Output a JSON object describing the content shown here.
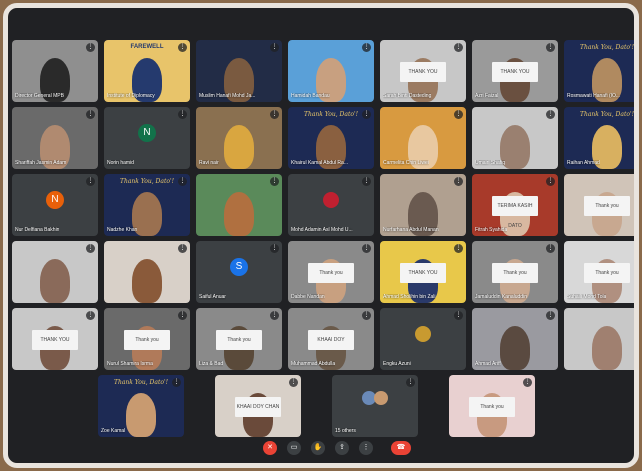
{
  "meeting": {
    "participants": [
      {
        "name": "Director General MPB",
        "bg": "#8f8f8f",
        "person": "#2a2a2a",
        "type": "video"
      },
      {
        "name": "Institute of Diplomacy",
        "bg": "#e8c46a",
        "person": "#253a6e",
        "type": "farewell",
        "banner": "FAREWELL"
      },
      {
        "name": "Muslim Hanafi Mohd Ja...",
        "bg": "#222c46",
        "person": "#7a5a40",
        "type": "video"
      },
      {
        "name": "Hamidah Bandau",
        "bg": "#5aa0d8",
        "person": "#c8a080",
        "type": "sign"
      },
      {
        "name": "Sarah Binti Dasteding",
        "bg": "#c7c7c7",
        "person": "#9b7b62",
        "type": "sign",
        "sign": "THANK YOU"
      },
      {
        "name": "Azri Faizal",
        "bg": "#9a9a9a",
        "person": "#6a5040",
        "type": "sign",
        "sign": "THANK YOU"
      },
      {
        "name": "Rosmawati Hanafi (IO...",
        "bg": "#1d2a54",
        "person": "#b08a60",
        "type": "banner",
        "banner": "Thank You, Dato'!"
      },
      {
        "name": "Shariffah Jasmin Adam",
        "bg": "#6a6a6a",
        "person": "#b08a70",
        "type": "video"
      },
      {
        "name": "Norin hamid",
        "bg": "#3c4043",
        "type": "avatar",
        "initial": "N",
        "avatar_color": "#12724a"
      },
      {
        "name": "Ravi nair",
        "bg": "#8a7050",
        "person": "#d9a640",
        "type": "video"
      },
      {
        "name": "Khairul Kamal Abdul Ra...",
        "bg": "#1d2a54",
        "person": "#8a6040",
        "type": "banner",
        "banner": "Thank You, Dato'!"
      },
      {
        "name": "Carmelita Chin Liwei",
        "bg": "#d89a40",
        "person": "#e8c8a0",
        "type": "video"
      },
      {
        "name": "Umairi Shafiq",
        "bg": "#c8c8c8",
        "person": "#9a8070",
        "type": "video"
      },
      {
        "name": "Raihan Ahmad",
        "bg": "#1d2a54",
        "person": "#d8b060",
        "type": "banner",
        "banner": "Thank You, Dato'!"
      },
      {
        "name": "Nur Delfiana Bakhin",
        "bg": "#3c4043",
        "type": "avatar",
        "initial": "N",
        "avatar_color": "#e8600a"
      },
      {
        "name": "Nadzhe Khan",
        "bg": "#1d2a54",
        "person": "#9a7050",
        "type": "banner",
        "banner": "Thank You, Dato'!"
      },
      {
        "name": "",
        "bg": "#5a8a5a",
        "person": "#b07040",
        "type": "video"
      },
      {
        "name": "Mohd Adamin Asl Mohd U...",
        "bg": "#3c4043",
        "person": "#c02030",
        "type": "small"
      },
      {
        "name": "Nurfarhana Abdul Manan",
        "bg": "#b0a090",
        "person": "#6a5a50",
        "type": "video"
      },
      {
        "name": "Fitrah Syahida",
        "bg": "#a83a2a",
        "person": "#d8b8a0",
        "type": "sign",
        "sign": "TERIMA KASIH DATO"
      },
      {
        "name": "",
        "bg": "#d0c4b8",
        "person": "#c8a890",
        "type": "sign",
        "sign": "Thank you"
      },
      {
        "name": "",
        "bg": "#c8c8c8",
        "person": "#8a6a5a",
        "type": "video"
      },
      {
        "name": "",
        "bg": "#d8d0c8",
        "person": "#8a5a3a",
        "type": "video"
      },
      {
        "name": "Saiful Anuar",
        "bg": "#3c4043",
        "type": "avatar",
        "initial": "S",
        "avatar_color": "#1a73e8"
      },
      {
        "name": "Dabbe Nandan",
        "bg": "#8a8a8a",
        "person": "#c8a080",
        "type": "sign",
        "sign": "Thank you"
      },
      {
        "name": "Ahmad Sholihin bin Zali",
        "bg": "#e8c84a",
        "person": "#2a3a6a",
        "type": "sign",
        "sign": "THANK YOU"
      },
      {
        "name": "Jamaluddin Kanaluddin",
        "bg": "#8a8a8a",
        "person": "#c8a890",
        "type": "sign",
        "sign": "Thank you"
      },
      {
        "name": "Suhaili Mohd Tola",
        "bg": "#d8d8d8",
        "person": "#b09080",
        "type": "sign",
        "sign": "Thank you"
      },
      {
        "name": "",
        "bg": "#c8c8c8",
        "person": "#7a5a4a",
        "type": "sign",
        "sign": "THANK YOU"
      },
      {
        "name": "Nurul Shamira Isrma",
        "bg": "#6a6a6a",
        "person": "#b07a5a",
        "type": "sign",
        "sign": "Thank you"
      },
      {
        "name": "Liza & Bad",
        "bg": "#8a8a8a",
        "person": "#5a4a3a",
        "type": "sign",
        "sign": "Thank you"
      },
      {
        "name": "Muhammad Abdulla",
        "bg": "#8a8a8a",
        "person": "#6a5a4a",
        "type": "sign",
        "sign": "KHAAI DOY"
      },
      {
        "name": "Engku Azuni",
        "bg": "#3c4043",
        "person": "#c89a30",
        "type": "small"
      },
      {
        "name": "Ahmad Ariff",
        "bg": "#9a9aa0",
        "person": "#5a4a40",
        "type": "video"
      },
      {
        "name": "",
        "bg": "#c8c8c8",
        "person": "#a08070",
        "type": "video"
      },
      {
        "name": "Zoe Kamal",
        "bg": "#1d2a54",
        "person": "#c89a70",
        "type": "banner",
        "banner": "Thank You, Dato'!"
      },
      {
        "name": "",
        "bg": "#d8d0c8",
        "person": "#6a4a3a",
        "type": "sign",
        "sign": "KHAAI DOY CHAN"
      },
      {
        "name": "15 others",
        "bg": "#3c4043",
        "type": "others"
      },
      {
        "name": "",
        "bg": "#e8d0d0",
        "person": "#c89a80",
        "type": "sign",
        "sign": "Thank you"
      }
    ]
  },
  "toolbar": {
    "buttons": [
      {
        "icon": "mic-off-icon",
        "glyph": "✕",
        "color": "#ea4335"
      },
      {
        "icon": "camera-icon",
        "glyph": "▭",
        "color": "#3c4043"
      },
      {
        "icon": "raise-hand-icon",
        "glyph": "✋",
        "color": "#3c4043"
      },
      {
        "icon": "present-icon",
        "glyph": "⇪",
        "color": "#3c4043"
      },
      {
        "icon": "more-options-icon",
        "glyph": "⋮",
        "color": "#3c4043"
      },
      {
        "icon": "end-call-icon",
        "glyph": "☎",
        "color": "#ea4335"
      }
    ]
  }
}
